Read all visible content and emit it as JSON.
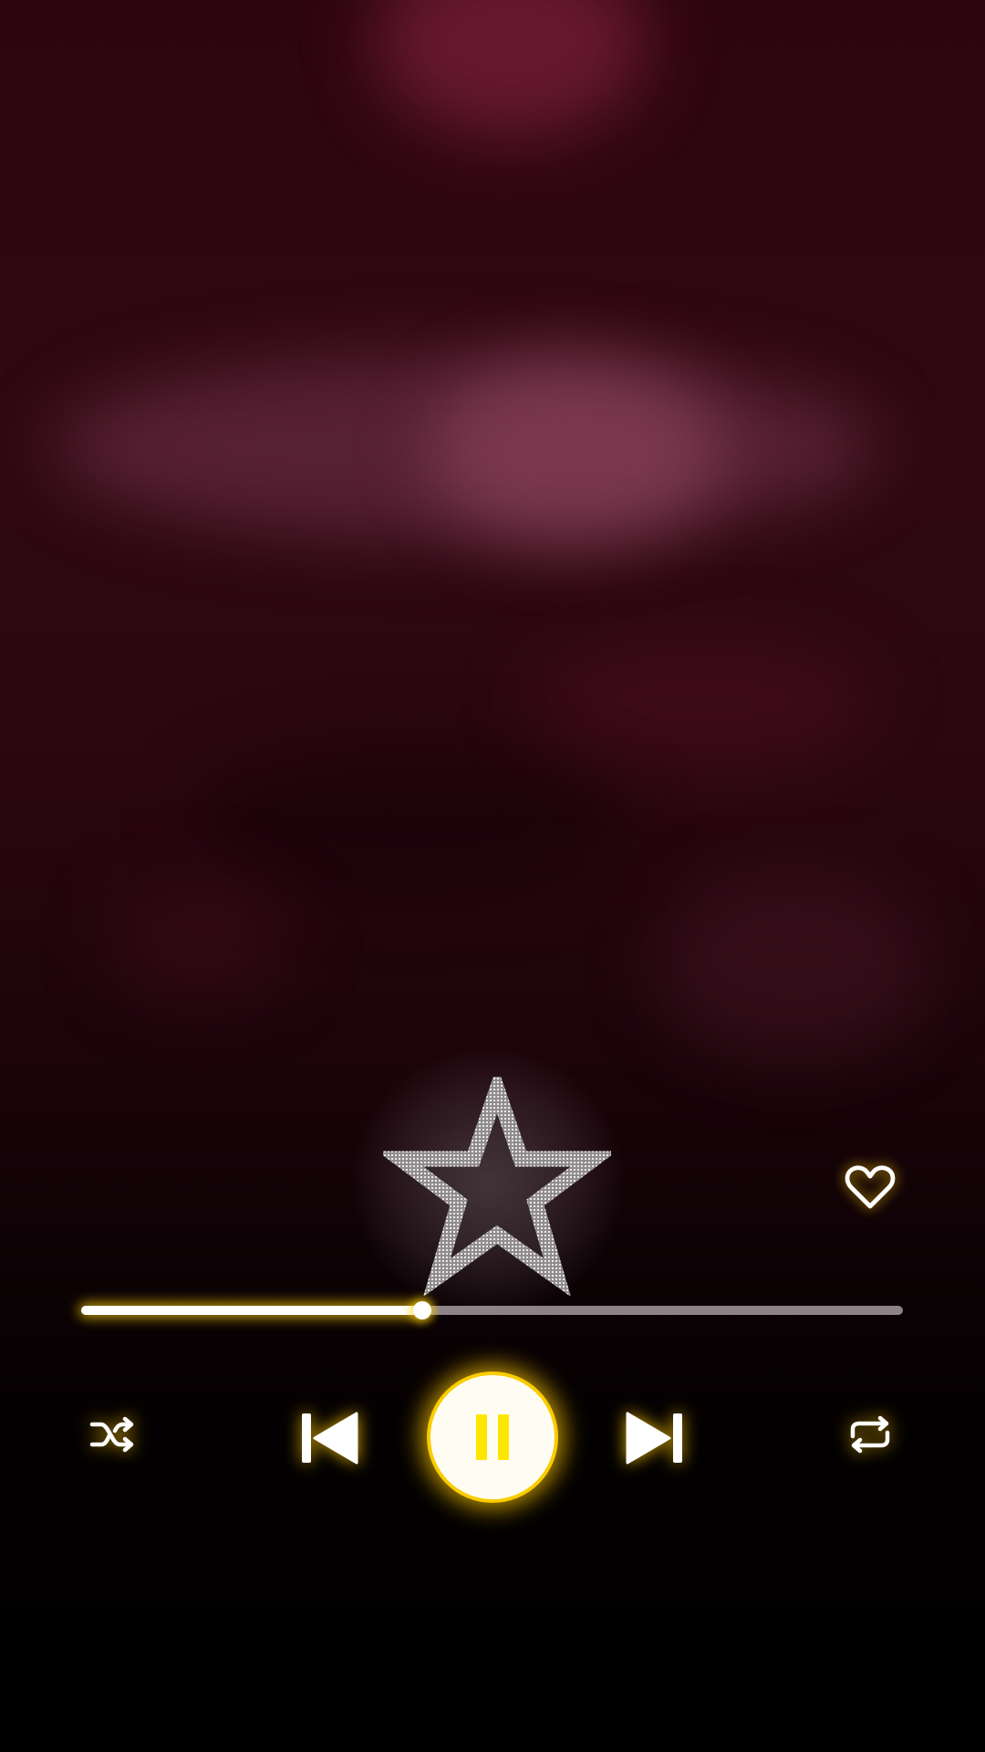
{
  "player": {
    "progress_fraction": 0.415,
    "accent_color": "#ffd200",
    "state": "playing"
  },
  "icons": {
    "artwork": "star-outline-icon",
    "favorite": "heart-outline-icon",
    "shuffle": "shuffle-icon",
    "previous": "skip-previous-icon",
    "play_pause": "pause-icon",
    "next": "skip-next-icon",
    "repeat": "repeat-icon"
  }
}
